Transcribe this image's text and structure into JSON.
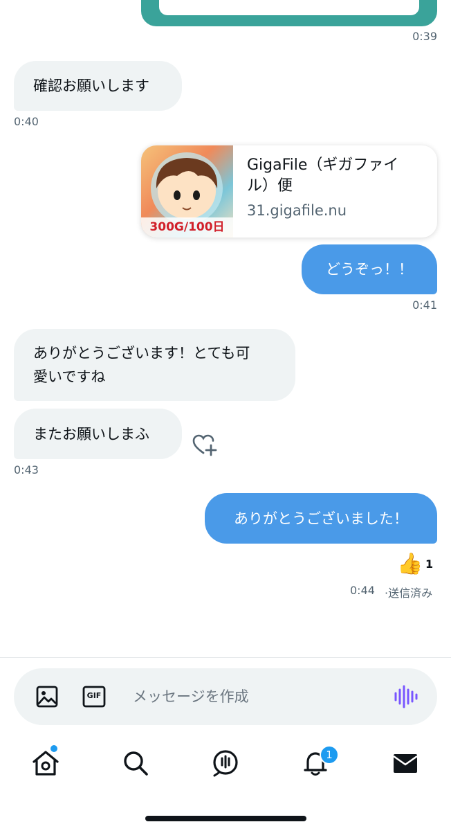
{
  "messages": {
    "ts_039": "0:39",
    "m1": {
      "text": "確認お願いします",
      "time": "0:40"
    },
    "link": {
      "title_line1": "GigaFile（ギガファイ",
      "title_line2": "ル）便",
      "domain": "31.gigafile.nu",
      "thumb_text": "300G/100日"
    },
    "m2": {
      "text": "どうぞっ！！",
      "time": "0:41"
    },
    "m3": {
      "line1": "ありがとうございます！とても可",
      "line2": "愛いですね"
    },
    "m4": {
      "text": "またお願いしまふ",
      "time": "0:43"
    },
    "m5": {
      "text": "ありがとうございました！"
    },
    "reaction": {
      "emoji": "👍",
      "count": "1"
    },
    "status": {
      "time": "0:44",
      "label": "·送信済み"
    }
  },
  "composer": {
    "placeholder": "メッセージを作成",
    "gif_label": "GIF"
  },
  "nav": {
    "notification_count": "1"
  },
  "colors": {
    "sent_bubble": "#4a9ae8",
    "received_bubble": "#eff3f4",
    "accent": "#1d9bf0",
    "voice": "#7856ff"
  },
  "icons": [
    "image-icon",
    "gif-icon",
    "voice-wave-icon",
    "heart-plus-icon",
    "home-icon",
    "search-icon",
    "spaces-icon",
    "bell-icon",
    "mail-icon"
  ]
}
